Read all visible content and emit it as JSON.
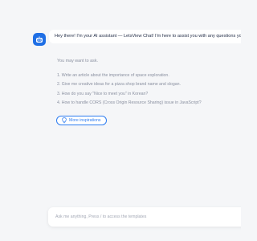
{
  "chat": {
    "greeting": "Hey there! I'm your AI assistant — LetsView Chat! I'm here to assist you with any questions you have! Just ask me!"
  },
  "suggestions": {
    "title": "You may want to ask.",
    "items": [
      "1. Write an article about the importance of space exploration.",
      "2. Give me creative ideas for a pizza shop brand name and slogan.",
      "3. How do you say \"Nice to meet you\" in Korean?",
      "4. How to handle CORS (Cross Origin Resource Sharing) issue in JavaScript?"
    ],
    "more_label": "More inspirations"
  },
  "composer": {
    "placeholder": "Ask me anything, Press / to access the templates"
  },
  "colors": {
    "accent": "#2d7cf0",
    "avatar_bg": "#1f6fe5",
    "page_bg": "#f5f6f8"
  },
  "icons": {
    "avatar": "robot-icon",
    "more": "lightbulb-icon"
  }
}
